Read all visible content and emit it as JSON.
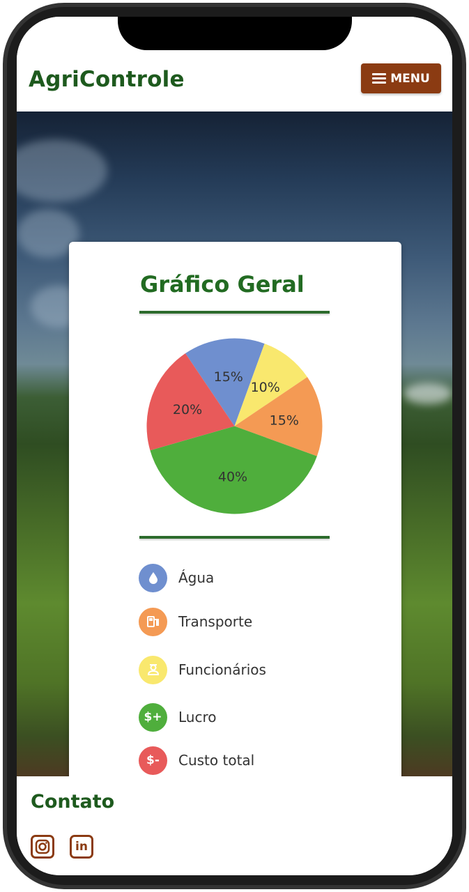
{
  "header": {
    "brand": "AgriControle",
    "menu_label": "MENU"
  },
  "card": {
    "title": "Gráfico Geral",
    "legend": [
      {
        "label": "Água",
        "icon": "water-drop-icon",
        "color": "#6f8fcf"
      },
      {
        "label": "Transporte",
        "icon": "fuel-pump-icon",
        "color": "#f49a54"
      },
      {
        "label": "Funcionários",
        "icon": "worker-icon",
        "color": "#f9e86e"
      },
      {
        "label": "Lucro",
        "icon": "dollar-plus-icon",
        "color": "#4fae3c"
      },
      {
        "label": "Custo total",
        "icon": "dollar-minus-icon",
        "color": "#e85a5a"
      }
    ]
  },
  "chart_data": {
    "type": "pie",
    "slices": [
      {
        "category": "Água",
        "value": 15,
        "label": "15%",
        "color": "#6f8fcf"
      },
      {
        "category": "Funcionários",
        "value": 10,
        "label": "10%",
        "color": "#f9e86e"
      },
      {
        "category": "Transporte",
        "value": 15,
        "label": "15%",
        "color": "#f49a54"
      },
      {
        "category": "Lucro",
        "value": 40,
        "label": "40%",
        "color": "#4fae3c"
      },
      {
        "category": "Custo total",
        "value": 20,
        "label": "20%",
        "color": "#e85a5a"
      }
    ],
    "title": "Gráfico Geral"
  },
  "footer": {
    "contact_title": "Contato",
    "social": [
      "instagram-icon",
      "linkedin-icon"
    ]
  }
}
